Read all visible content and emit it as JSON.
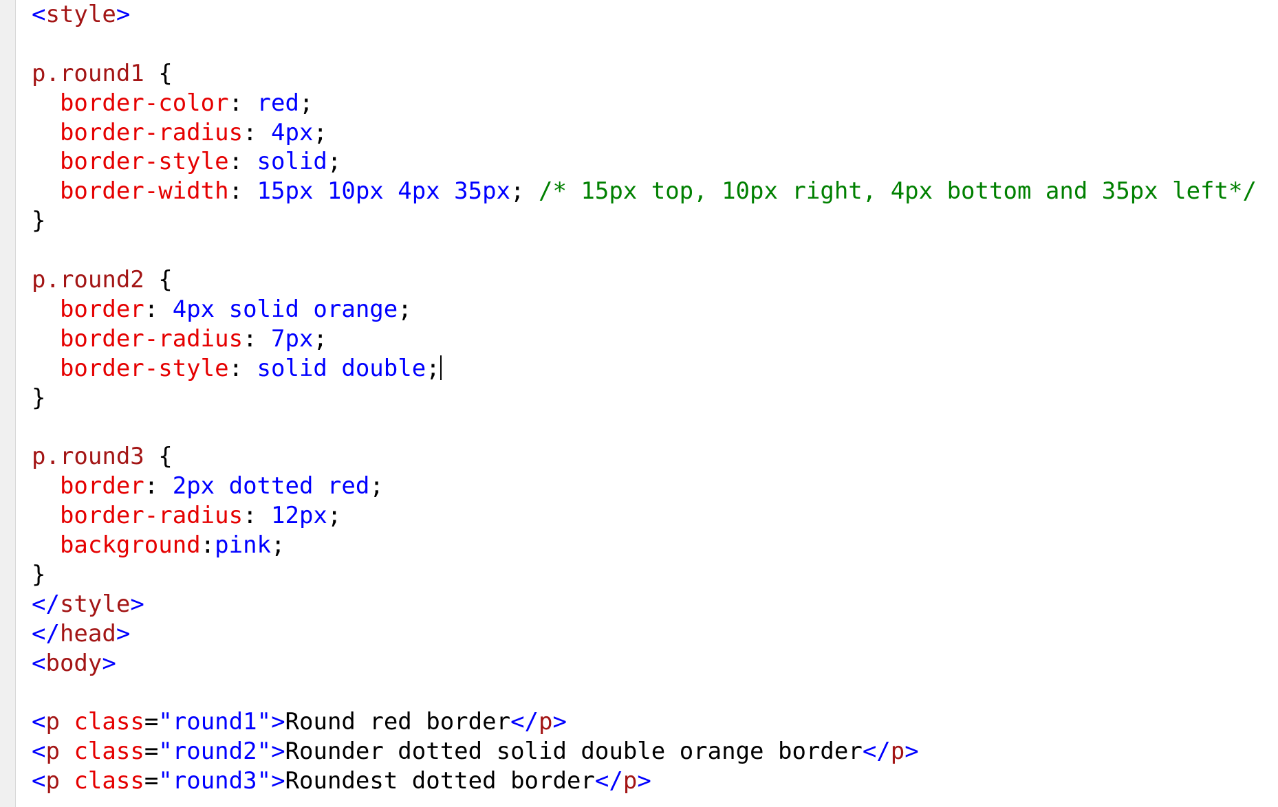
{
  "editor": {
    "lines": [
      [
        {
          "t": "<",
          "c": "punct"
        },
        {
          "t": "style",
          "c": "tag"
        },
        {
          "t": ">",
          "c": "punct"
        }
      ],
      [],
      [
        {
          "t": "p.round1",
          "c": "sel"
        },
        {
          "t": " {",
          "c": "brace"
        }
      ],
      [
        {
          "t": "  ",
          "c": "text"
        },
        {
          "t": "border-color",
          "c": "prop"
        },
        {
          "t": ": ",
          "c": "colon"
        },
        {
          "t": "red",
          "c": "val"
        },
        {
          "t": ";",
          "c": "colon"
        }
      ],
      [
        {
          "t": "  ",
          "c": "text"
        },
        {
          "t": "border-radius",
          "c": "prop"
        },
        {
          "t": ": ",
          "c": "colon"
        },
        {
          "t": "4px",
          "c": "val"
        },
        {
          "t": ";",
          "c": "colon"
        }
      ],
      [
        {
          "t": "  ",
          "c": "text"
        },
        {
          "t": "border-style",
          "c": "prop"
        },
        {
          "t": ": ",
          "c": "colon"
        },
        {
          "t": "solid",
          "c": "val"
        },
        {
          "t": ";",
          "c": "colon"
        }
      ],
      [
        {
          "t": "  ",
          "c": "text"
        },
        {
          "t": "border-width",
          "c": "prop"
        },
        {
          "t": ": ",
          "c": "colon"
        },
        {
          "t": "15px 10px 4px 35px",
          "c": "val"
        },
        {
          "t": "; ",
          "c": "colon"
        },
        {
          "t": "/* 15px top, 10px right, 4px bottom and 35px left*/",
          "c": "comment"
        }
      ],
      [
        {
          "t": "}",
          "c": "brace"
        }
      ],
      [],
      [
        {
          "t": "p.round2",
          "c": "sel"
        },
        {
          "t": " {",
          "c": "brace"
        }
      ],
      [
        {
          "t": "  ",
          "c": "text"
        },
        {
          "t": "border",
          "c": "prop"
        },
        {
          "t": ": ",
          "c": "colon"
        },
        {
          "t": "4px solid orange",
          "c": "val"
        },
        {
          "t": ";",
          "c": "colon"
        }
      ],
      [
        {
          "t": "  ",
          "c": "text"
        },
        {
          "t": "border-radius",
          "c": "prop"
        },
        {
          "t": ": ",
          "c": "colon"
        },
        {
          "t": "7px",
          "c": "val"
        },
        {
          "t": ";",
          "c": "colon"
        }
      ],
      [
        {
          "t": "  ",
          "c": "text"
        },
        {
          "t": "border-style",
          "c": "prop"
        },
        {
          "t": ": ",
          "c": "colon"
        },
        {
          "t": "solid double",
          "c": "val"
        },
        {
          "t": ";",
          "c": "colon"
        },
        {
          "t": "",
          "c": "caret"
        }
      ],
      [
        {
          "t": "}",
          "c": "brace"
        }
      ],
      [],
      [
        {
          "t": "p.round3",
          "c": "sel"
        },
        {
          "t": " {",
          "c": "brace"
        }
      ],
      [
        {
          "t": "  ",
          "c": "text"
        },
        {
          "t": "border",
          "c": "prop"
        },
        {
          "t": ": ",
          "c": "colon"
        },
        {
          "t": "2px dotted red",
          "c": "val"
        },
        {
          "t": ";",
          "c": "colon"
        }
      ],
      [
        {
          "t": "  ",
          "c": "text"
        },
        {
          "t": "border-radius",
          "c": "prop"
        },
        {
          "t": ": ",
          "c": "colon"
        },
        {
          "t": "12px",
          "c": "val"
        },
        {
          "t": ";",
          "c": "colon"
        }
      ],
      [
        {
          "t": "  ",
          "c": "text"
        },
        {
          "t": "background",
          "c": "prop"
        },
        {
          "t": ":",
          "c": "colon"
        },
        {
          "t": "pink",
          "c": "val"
        },
        {
          "t": ";",
          "c": "colon"
        }
      ],
      [
        {
          "t": "}",
          "c": "brace"
        }
      ],
      [
        {
          "t": "</",
          "c": "punct"
        },
        {
          "t": "style",
          "c": "tag"
        },
        {
          "t": ">",
          "c": "punct"
        }
      ],
      [
        {
          "t": "</",
          "c": "punct"
        },
        {
          "t": "head",
          "c": "tag"
        },
        {
          "t": ">",
          "c": "punct"
        }
      ],
      [
        {
          "t": "<",
          "c": "punct"
        },
        {
          "t": "body",
          "c": "tag"
        },
        {
          "t": ">",
          "c": "punct"
        }
      ],
      [],
      [
        {
          "t": "<",
          "c": "punct"
        },
        {
          "t": "p",
          "c": "tag"
        },
        {
          "t": " ",
          "c": "text"
        },
        {
          "t": "class",
          "c": "attr"
        },
        {
          "t": "=",
          "c": "text"
        },
        {
          "t": "\"round1\"",
          "c": "str"
        },
        {
          "t": ">",
          "c": "punct"
        },
        {
          "t": "Round red border",
          "c": "text"
        },
        {
          "t": "</",
          "c": "punct"
        },
        {
          "t": "p",
          "c": "tag"
        },
        {
          "t": ">",
          "c": "punct"
        }
      ],
      [
        {
          "t": "<",
          "c": "punct"
        },
        {
          "t": "p",
          "c": "tag"
        },
        {
          "t": " ",
          "c": "text"
        },
        {
          "t": "class",
          "c": "attr"
        },
        {
          "t": "=",
          "c": "text"
        },
        {
          "t": "\"round2\"",
          "c": "str"
        },
        {
          "t": ">",
          "c": "punct"
        },
        {
          "t": "Rounder dotted solid double orange border",
          "c": "text"
        },
        {
          "t": "</",
          "c": "punct"
        },
        {
          "t": "p",
          "c": "tag"
        },
        {
          "t": ">",
          "c": "punct"
        }
      ],
      [
        {
          "t": "<",
          "c": "punct"
        },
        {
          "t": "p",
          "c": "tag"
        },
        {
          "t": " ",
          "c": "text"
        },
        {
          "t": "class",
          "c": "attr"
        },
        {
          "t": "=",
          "c": "text"
        },
        {
          "t": "\"round3\"",
          "c": "str"
        },
        {
          "t": ">",
          "c": "punct"
        },
        {
          "t": "Roundest dotted border",
          "c": "text"
        },
        {
          "t": "</",
          "c": "punct"
        },
        {
          "t": "p",
          "c": "tag"
        },
        {
          "t": ">",
          "c": "punct"
        }
      ]
    ]
  },
  "colors": {
    "tag": "#a31515",
    "punct": "#0000ff",
    "property": "#e50000",
    "value": "#0000ff",
    "comment": "#008000",
    "text": "#000000"
  }
}
